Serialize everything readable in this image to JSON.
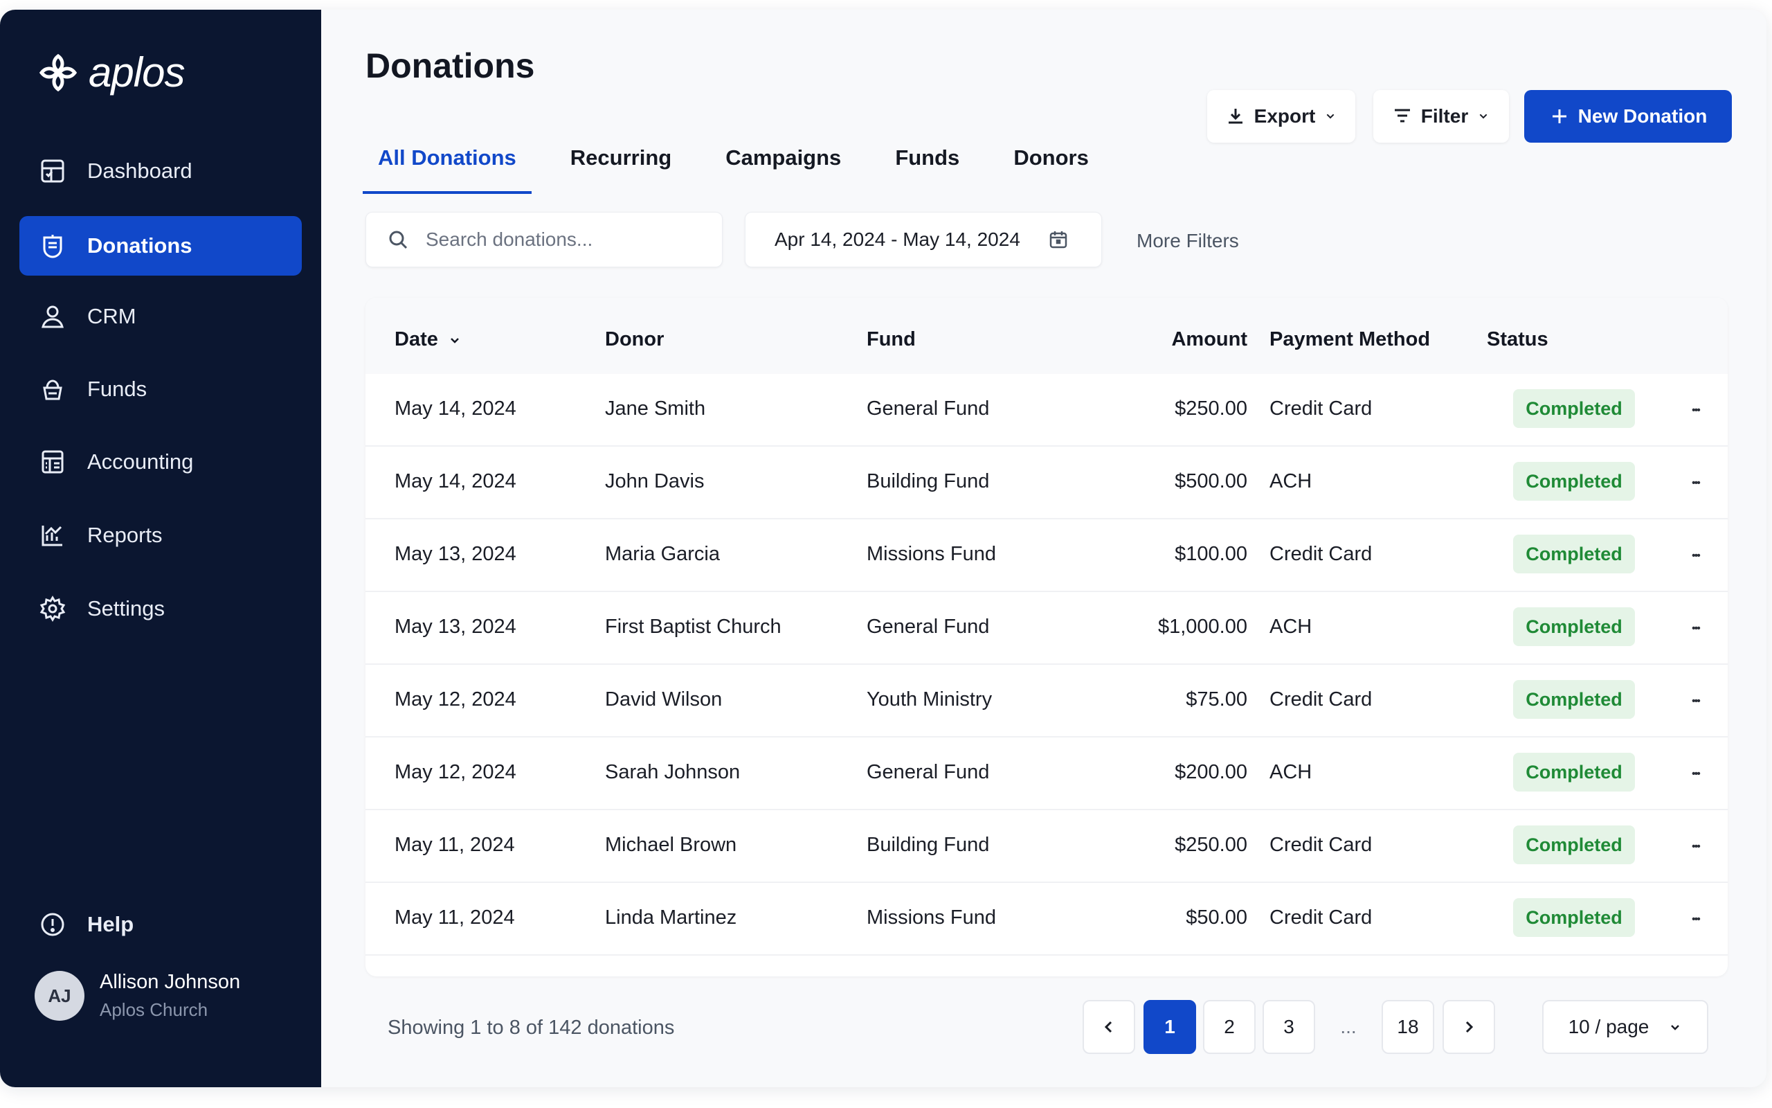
{
  "app": {
    "brand": "aplos"
  },
  "sidebar": {
    "items": [
      {
        "label": "Dashboard",
        "icon": "dashboard-icon"
      },
      {
        "label": "Donations",
        "icon": "donations-icon",
        "active": true
      },
      {
        "label": "CRM",
        "icon": "user-icon"
      },
      {
        "label": "Funds",
        "icon": "funds-icon"
      },
      {
        "label": "Accounting",
        "icon": "accounting-icon"
      },
      {
        "label": "Reports",
        "icon": "reports-icon"
      },
      {
        "label": "Settings",
        "icon": "gear-icon"
      }
    ],
    "help_label": "Help",
    "user": {
      "initials": "AJ",
      "name": "Allison Johnson",
      "org": "Aplos Church"
    }
  },
  "header": {
    "title": "Donations",
    "export_label": "Export",
    "filter_label": "Filter",
    "new_label": "New Donation"
  },
  "tabs": [
    {
      "label": "All Donations",
      "active": true
    },
    {
      "label": "Recurring"
    },
    {
      "label": "Campaigns"
    },
    {
      "label": "Funds"
    },
    {
      "label": "Donors"
    }
  ],
  "toolbar": {
    "search_placeholder": "Search donations...",
    "date_range": "Apr 14, 2024 - May 14, 2024",
    "more_filters": "More Filters"
  },
  "table": {
    "columns": [
      "Date",
      "Donor",
      "Fund",
      "Amount",
      "Payment Method",
      "Status"
    ],
    "rows": [
      {
        "date": "May 14, 2024",
        "donor": "Jane Smith",
        "fund": "General Fund",
        "amount": "$250.00",
        "method": "Credit Card",
        "status": "Completed"
      },
      {
        "date": "May 14, 2024",
        "donor": "John Davis",
        "fund": "Building Fund",
        "amount": "$500.00",
        "method": "ACH",
        "status": "Completed"
      },
      {
        "date": "May 13, 2024",
        "donor": "Maria Garcia",
        "fund": "Missions Fund",
        "amount": "$100.00",
        "method": "Credit Card",
        "status": "Completed"
      },
      {
        "date": "May 13, 2024",
        "donor": "First Baptist Church",
        "fund": "General Fund",
        "amount": "$1,000.00",
        "method": "ACH",
        "status": "Completed"
      },
      {
        "date": "May 12, 2024",
        "donor": "David Wilson",
        "fund": "Youth Ministry",
        "amount": "$75.00",
        "method": "Credit Card",
        "status": "Completed"
      },
      {
        "date": "May 12, 2024",
        "donor": "Sarah Johnson",
        "fund": "General Fund",
        "amount": "$200.00",
        "method": "ACH",
        "status": "Completed"
      },
      {
        "date": "May 11, 2024",
        "donor": "Michael Brown",
        "fund": "Building Fund",
        "amount": "$250.00",
        "method": "Credit Card",
        "status": "Completed"
      },
      {
        "date": "May 11, 2024",
        "donor": "Linda Martinez",
        "fund": "Missions Fund",
        "amount": "$50.00",
        "method": "Credit Card",
        "status": "Completed"
      }
    ]
  },
  "footer": {
    "showing": "Showing 1 to 8 of 142 donations",
    "pages": [
      "1",
      "2",
      "3",
      "...",
      "18"
    ],
    "current_page": "1",
    "per_page": "10 / page"
  },
  "colors": {
    "sidebar": "#0b1630",
    "accent": "#1148c9",
    "status_bg": "#e5f4e7",
    "status_text": "#1f8a36"
  }
}
